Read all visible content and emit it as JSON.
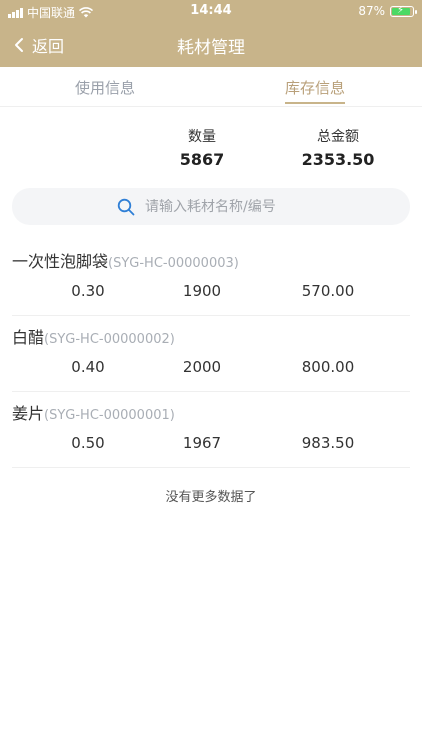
{
  "status_bar": {
    "carrier": "中国联通",
    "time": "14:44",
    "battery": "87%"
  },
  "nav": {
    "back_label": "返回",
    "title": "耗材管理"
  },
  "tabs": [
    {
      "label": "使用信息",
      "active": false
    },
    {
      "label": "库存信息",
      "active": true
    }
  ],
  "summary": {
    "qty_label": "数量",
    "qty_value": "5867",
    "amount_label": "总金额",
    "amount_value": "2353.50"
  },
  "search": {
    "placeholder": "请输入耗材名称/编号"
  },
  "items": [
    {
      "name": "一次性泡脚袋",
      "code": "(SYG-HC-00000003)",
      "price": "0.30",
      "quantity": "1900",
      "total": "570.00"
    },
    {
      "name": "白醋",
      "code": "(SYG-HC-00000002)",
      "price": "0.40",
      "quantity": "2000",
      "total": "800.00"
    },
    {
      "name": "姜片",
      "code": "(SYG-HC-00000001)",
      "price": "0.50",
      "quantity": "1967",
      "total": "983.50"
    }
  ],
  "footer": {
    "no_more": "没有更多数据了"
  },
  "colors": {
    "header": "#c8b48a",
    "active_tab": "#b9a07a",
    "search_icon": "#2f7fd6"
  }
}
